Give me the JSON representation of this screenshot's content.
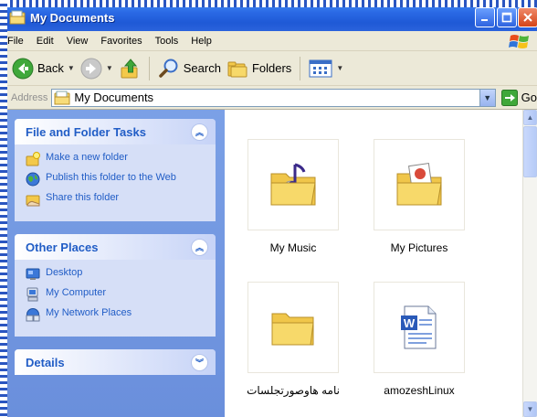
{
  "window": {
    "title": "My Documents"
  },
  "menu": {
    "items": [
      "File",
      "Edit",
      "View",
      "Favorites",
      "Tools",
      "Help"
    ]
  },
  "toolbar": {
    "back_label": "Back",
    "search_label": "Search",
    "folders_label": "Folders"
  },
  "address": {
    "label": "Address",
    "value": "My Documents",
    "go_label": "Go"
  },
  "tasks": {
    "file_folder": {
      "title": "File and Folder Tasks",
      "items": [
        {
          "label": "Make a new folder",
          "icon": "new-folder-icon"
        },
        {
          "label": "Publish this folder to the Web",
          "icon": "globe-icon"
        },
        {
          "label": "Share this folder",
          "icon": "share-folder-icon"
        }
      ]
    },
    "other_places": {
      "title": "Other Places",
      "items": [
        {
          "label": "Desktop",
          "icon": "desktop-icon"
        },
        {
          "label": "My Computer",
          "icon": "computer-icon"
        },
        {
          "label": "My Network Places",
          "icon": "network-icon"
        }
      ]
    },
    "details": {
      "title": "Details"
    }
  },
  "files": [
    {
      "name": "My Music",
      "icon": "music-folder-icon"
    },
    {
      "name": "My Pictures",
      "icon": "pictures-folder-icon"
    },
    {
      "name": "نامه هاوصورتجلسات",
      "icon": "folder-icon"
    },
    {
      "name": "amozeshLinux",
      "icon": "word-document-icon"
    }
  ],
  "colors": {
    "titlebar": "#2b6ae6",
    "taskpane": "#7ba0e6",
    "link": "#215dc6",
    "chrome": "#ece9d8"
  }
}
